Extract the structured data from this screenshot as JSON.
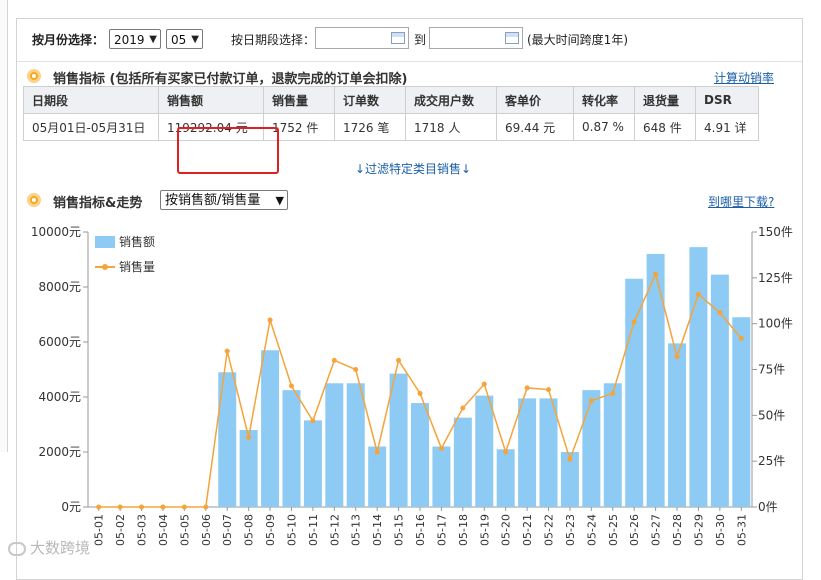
{
  "filters": {
    "month_label": "按月份选择：",
    "year_value": "2019",
    "month_value": "05",
    "date_range_label": "按日期段选择：",
    "to_label": "到",
    "max_span_note": "(最大时间跨度1年)"
  },
  "sales_section": {
    "title": "销售指标 (包括所有买家已付款订单，退款完成的订单会扣除)",
    "calc_link": "计算动销率",
    "headers": [
      "日期段",
      "销售额",
      "销售量",
      "订单数",
      "成交用户数",
      "客单价",
      "转化率",
      "退货量",
      "DSR"
    ],
    "row": [
      "05月01日-05月31日",
      "119292.04  元",
      "1752  件",
      "1726  笔",
      "1718  人",
      "69.44  元",
      "0.87  %",
      "648  件",
      "4.91  详"
    ],
    "filter_link": "↓过滤特定类目销售↓"
  },
  "trend_section": {
    "title": "销售指标&走势",
    "select_value": "按销售额/销售量",
    "download_link": "到哪里下载?"
  },
  "watermark": "大数跨境",
  "colors": {
    "bar": "#8ecbf4",
    "line": "#f5a33a",
    "highlight": "#e02020",
    "bullet": "#f7a81b",
    "link": "#1a5fa8"
  },
  "chart_data": {
    "type": "bar",
    "categories": [
      "05-01",
      "05-02",
      "05-03",
      "05-04",
      "05-05",
      "05-06",
      "05-07",
      "05-08",
      "05-09",
      "05-10",
      "05-11",
      "05-12",
      "05-13",
      "05-14",
      "05-15",
      "05-16",
      "05-17",
      "05-18",
      "05-19",
      "05-20",
      "05-21",
      "05-22",
      "05-23",
      "05-24",
      "05-25",
      "05-26",
      "05-27",
      "05-28",
      "05-29",
      "05-30",
      "05-31"
    ],
    "series": [
      {
        "name": "销售额",
        "type": "bar",
        "axis": "left",
        "values": [
          0,
          0,
          0,
          0,
          0,
          0,
          4900,
          2800,
          5700,
          4250,
          3150,
          4500,
          4500,
          2200,
          4850,
          3780,
          2200,
          3250,
          4050,
          2100,
          3950,
          3950,
          2000,
          4250,
          4500,
          8300,
          9200,
          5950,
          9450,
          8450,
          6900
        ]
      },
      {
        "name": "销售量",
        "type": "line",
        "axis": "right",
        "values": [
          0,
          0,
          0,
          0,
          0,
          0,
          85,
          38,
          102,
          66,
          47,
          80,
          75,
          30,
          80,
          62,
          32,
          54,
          67,
          30,
          65,
          64,
          26,
          58,
          62,
          101,
          127,
          82,
          116,
          106,
          92
        ]
      }
    ],
    "y_left": {
      "min": 0,
      "max": 10000,
      "ticks": [
        "0元",
        "2000元",
        "4000元",
        "6000元",
        "8000元",
        "10000元"
      ]
    },
    "y_right": {
      "min": 0,
      "max": 150,
      "ticks": [
        "0件",
        "25件",
        "50件",
        "75件",
        "100件",
        "125件",
        "150件"
      ]
    },
    "legend_position": "top-left",
    "grid": false
  }
}
